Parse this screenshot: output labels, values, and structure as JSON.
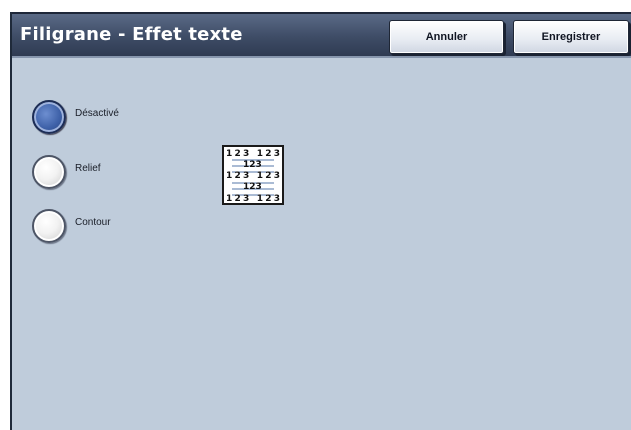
{
  "header": {
    "title": "Filigrane - Effet texte",
    "cancel_label": "Annuler",
    "save_label": "Enregistrer"
  },
  "options": [
    {
      "label": "Désactivé",
      "selected": true
    },
    {
      "label": "Relief",
      "selected": false
    },
    {
      "label": "Contour",
      "selected": false
    }
  ],
  "preview": {
    "rows": [
      "123 123",
      "123",
      "123 123",
      "123",
      "123 123"
    ]
  },
  "colors": {
    "background": "#bfccdb",
    "header": "#3e4c66",
    "selected_radio": "#3e61a8"
  }
}
